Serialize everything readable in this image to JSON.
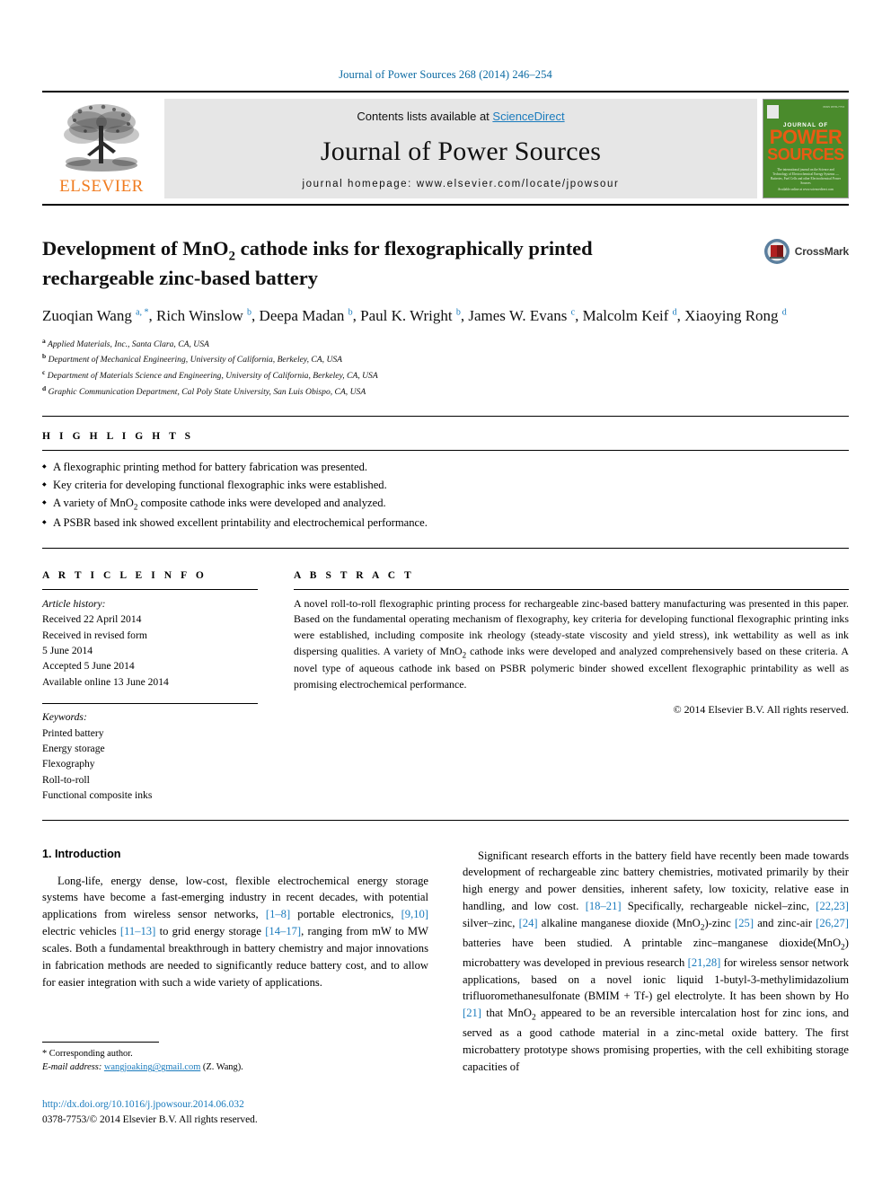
{
  "running_head": "Journal of Power Sources 268 (2014) 246–254",
  "masthead": {
    "publisher_word": "ELSEVIER",
    "contents_prefix": "Contents lists available at ",
    "contents_link": "ScienceDirect",
    "journal_name": "Journal of Power Sources",
    "homepage": "journal homepage: www.elsevier.com/locate/jpowsour",
    "cover": {
      "journal_of": "JOURNAL OF",
      "power": "POWER",
      "sources": "SOURCES",
      "subtitle": "The international journal on the Science and Technology of Electrochemical Energy Systems — Batteries, Fuel Cells and other Electrochemical Power Sources",
      "bottom": "Available online at www.sciencedirect.com"
    }
  },
  "article": {
    "title_line1": "Development of MnO",
    "title_sub1": "2",
    "title_line1b": " cathode inks for flexographically printed",
    "title_line2": "rechargeable zinc-based battery",
    "crossmark_label": "CrossMark",
    "authors_html": "Zuoqian Wang, Rich Winslow, Deepa Madan, Paul K. Wright, James W. Evans, Malcolm Keif, Xiaoying Rong",
    "authors": [
      {
        "name": "Zuoqian Wang",
        "marks": "a, *"
      },
      {
        "name": "Rich Winslow",
        "marks": "b"
      },
      {
        "name": "Deepa Madan",
        "marks": "b"
      },
      {
        "name": "Paul K. Wright",
        "marks": "b"
      },
      {
        "name": "James W. Evans",
        "marks": "c"
      },
      {
        "name": "Malcolm Keif",
        "marks": "d"
      },
      {
        "name": "Xiaoying Rong",
        "marks": "d"
      }
    ],
    "affiliations": [
      {
        "mark": "a",
        "text": "Applied Materials, Inc., Santa Clara, CA, USA"
      },
      {
        "mark": "b",
        "text": "Department of Mechanical Engineering, University of California, Berkeley, CA, USA"
      },
      {
        "mark": "c",
        "text": "Department of Materials Science and Engineering, University of California, Berkeley, CA, USA"
      },
      {
        "mark": "d",
        "text": "Graphic Communication Department, Cal Poly State University, San Luis Obispo, CA, USA"
      }
    ]
  },
  "highlights": {
    "heading": "H I G H L I G H T S",
    "items": [
      "A flexographic printing method for battery fabrication was presented.",
      "Key criteria for developing functional flexographic inks were established.",
      "A variety of MnO2 composite cathode inks were developed and analyzed.",
      "A PSBR based ink showed excellent printability and electrochemical performance."
    ]
  },
  "article_info": {
    "heading": "A R T I C L E   I N F O",
    "history_label": "Article history:",
    "history": [
      "Received 22 April 2014",
      "Received in revised form",
      "5 June 2014",
      "Accepted 5 June 2014",
      "Available online 13 June 2014"
    ],
    "keywords_label": "Keywords:",
    "keywords": [
      "Printed battery",
      "Energy storage",
      "Flexography",
      "Roll-to-roll",
      "Functional composite inks"
    ]
  },
  "abstract": {
    "heading": "A B S T R A C T",
    "text": "A novel roll-to-roll flexographic printing process for rechargeable zinc-based battery manufacturing was presented in this paper. Based on the fundamental operating mechanism of flexography, key criteria for developing functional flexographic printing inks were established, including composite ink rheology (steady-state viscosity and yield stress), ink wettability as well as ink dispersing qualities. A variety of MnO2 cathode inks were developed and analyzed comprehensively based on these criteria. A novel type of aqueous cathode ink based on PSBR polymeric binder showed excellent flexographic printability as well as promising electrochemical performance.",
    "copyright": "© 2014 Elsevier B.V. All rights reserved."
  },
  "body": {
    "section_number_title": "1.  Introduction",
    "left_paragraph": "Long-life, energy dense, low-cost, flexible electrochemical energy storage systems have become a fast-emerging industry in recent decades, with potential applications from wireless sensor networks, [1–8] portable electronics, [9,10] electric vehicles [11–13] to grid energy storage [14–17], ranging from mW to MW scales. Both a fundamental breakthrough in battery chemistry and major innovations in fabrication methods are needed to significantly reduce battery cost, and to allow for easier integration with such a wide variety of applications.",
    "right_paragraph": "Significant research efforts in the battery field have recently been made towards development of rechargeable zinc battery chemistries, motivated primarily by their high energy and power densities, inherent safety, low toxicity, relative ease in handling, and low cost. [18–21] Specifically, rechargeable nickel–zinc, [22,23] silver–zinc, [24] alkaline manganese dioxide (MnO2)-zinc [25] and zinc-air [26,27] batteries have been studied. A printable zinc–manganese dioxide(MnO2) microbattery was developed in previous research [21,28] for wireless sensor network applications, based on a novel ionic liquid 1-butyl-3-methylimidazolium trifluoromethanesulfonate (BMIM + Tf-) gel electrolyte. It has been shown by Ho [21] that MnO2 appeared to be an reversible intercalation host for zinc ions, and served as a good cathode material in a zinc-metal oxide battery. The first microbattery prototype shows promising properties, with the cell exhibiting storage capacities of"
  },
  "footnote": {
    "corresponding": "* Corresponding author.",
    "email_label": "E-mail address:",
    "email": "wangjoaking@gmail.com",
    "email_suffix": "(Z. Wang)."
  },
  "footer": {
    "doi": "http://dx.doi.org/10.1016/j.jpowsour.2014.06.032",
    "issn_line": "0378-7753/© 2014 Elsevier B.V. All rights reserved."
  },
  "colors": {
    "link_blue": "#1a7bbd",
    "header_blue": "#0b6aa2",
    "elsevier_orange": "#f07c20",
    "cover_green": "#4a8b2c",
    "cover_orange": "#ea5a13"
  }
}
